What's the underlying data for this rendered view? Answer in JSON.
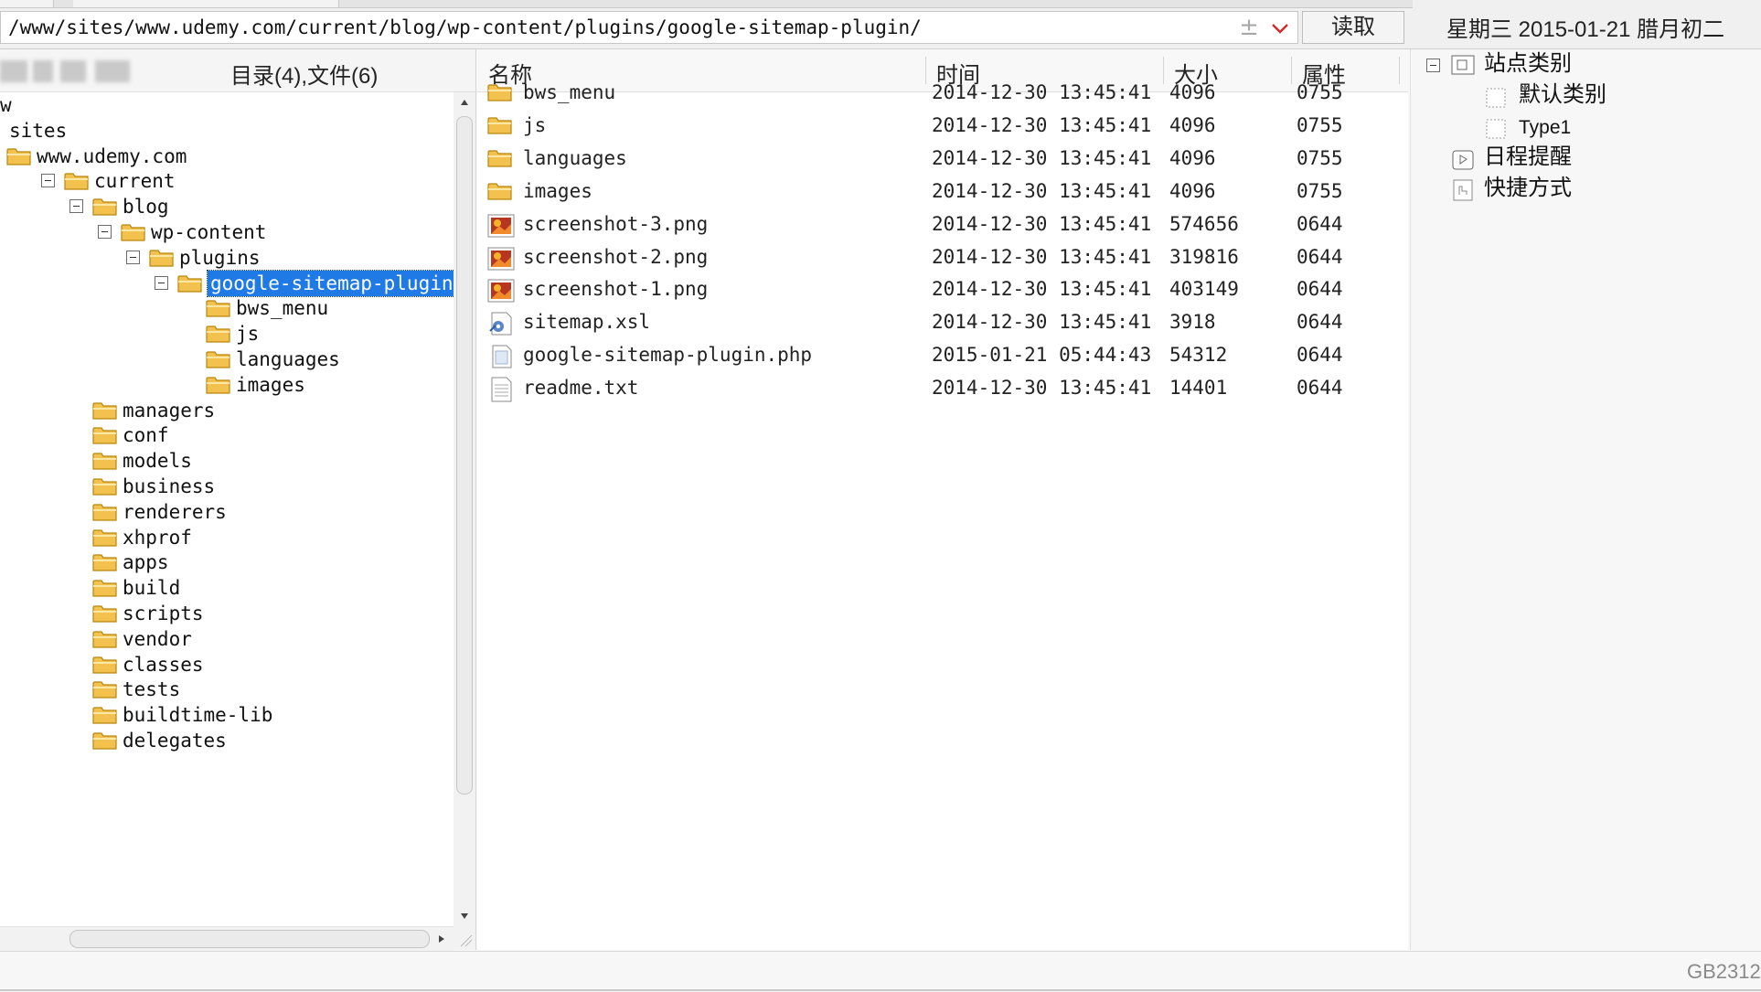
{
  "toolbar": {
    "path": "/www/sites/www.udemy.com/current/blog/wp-content/plugins/google-sitemap-plugin/",
    "bookmark_glyph": "±",
    "read_label": "读取",
    "date": "星期三  2015-01-21  腊月初二"
  },
  "left_panel": {
    "dir_count": "目录(4),文件(6)",
    "tree": [
      {
        "label": "w",
        "indent": 0,
        "type": "text"
      },
      {
        "label": "sites",
        "indent": 0,
        "type": "text"
      },
      {
        "label": "www.udemy.com",
        "indent": 0,
        "type": "folder",
        "toggle": false
      },
      {
        "label": "current",
        "indent": 1,
        "type": "folder",
        "toggle": true
      },
      {
        "label": "blog",
        "indent": 2,
        "type": "folder",
        "toggle": true
      },
      {
        "label": "wp-content",
        "indent": 3,
        "type": "folder",
        "toggle": true
      },
      {
        "label": "plugins",
        "indent": 4,
        "type": "folder",
        "toggle": true
      },
      {
        "label": "google-sitemap-plugin",
        "indent": 5,
        "type": "folder",
        "toggle": true,
        "selected": true
      },
      {
        "label": "bws_menu",
        "indent": 6,
        "type": "folder"
      },
      {
        "label": "js",
        "indent": 6,
        "type": "folder"
      },
      {
        "label": "languages",
        "indent": 6,
        "type": "folder"
      },
      {
        "label": "images",
        "indent": 6,
        "type": "folder"
      },
      {
        "label": "managers",
        "indent": 2,
        "type": "folder"
      },
      {
        "label": "conf",
        "indent": 2,
        "type": "folder"
      },
      {
        "label": "models",
        "indent": 2,
        "type": "folder"
      },
      {
        "label": "business",
        "indent": 2,
        "type": "folder"
      },
      {
        "label": "renderers",
        "indent": 2,
        "type": "folder"
      },
      {
        "label": "xhprof",
        "indent": 2,
        "type": "folder"
      },
      {
        "label": "apps",
        "indent": 2,
        "type": "folder"
      },
      {
        "label": "build",
        "indent": 2,
        "type": "folder"
      },
      {
        "label": "scripts",
        "indent": 2,
        "type": "folder"
      },
      {
        "label": "vendor",
        "indent": 2,
        "type": "folder"
      },
      {
        "label": "classes",
        "indent": 2,
        "type": "folder"
      },
      {
        "label": "tests",
        "indent": 2,
        "type": "folder"
      },
      {
        "label": "buildtime-lib",
        "indent": 2,
        "type": "folder"
      },
      {
        "label": "delegates",
        "indent": 2,
        "type": "folder"
      }
    ]
  },
  "file_list": {
    "columns": {
      "name": "名称",
      "time": "时间",
      "size": "大小",
      "attr": "属性"
    },
    "rows": [
      {
        "name": "bws_menu",
        "time": "2014-12-30 13:45:41",
        "size": "4096",
        "attr": "0755",
        "icon": "folder"
      },
      {
        "name": "js",
        "time": "2014-12-30 13:45:41",
        "size": "4096",
        "attr": "0755",
        "icon": "folder"
      },
      {
        "name": "languages",
        "time": "2014-12-30 13:45:41",
        "size": "4096",
        "attr": "0755",
        "icon": "folder"
      },
      {
        "name": "images",
        "time": "2014-12-30 13:45:41",
        "size": "4096",
        "attr": "0755",
        "icon": "folder"
      },
      {
        "name": "screenshot-3.png",
        "time": "2014-12-30 13:45:41",
        "size": "574656",
        "attr": "0644",
        "icon": "image"
      },
      {
        "name": "screenshot-2.png",
        "time": "2014-12-30 13:45:41",
        "size": "319816",
        "attr": "0644",
        "icon": "image"
      },
      {
        "name": "screenshot-1.png",
        "time": "2014-12-30 13:45:41",
        "size": "403149",
        "attr": "0644",
        "icon": "image"
      },
      {
        "name": "sitemap.xsl",
        "time": "2014-12-30 13:45:41",
        "size": "3918",
        "attr": "0644",
        "icon": "xsl"
      },
      {
        "name": "google-sitemap-plugin.php",
        "time": "2015-01-21 05:44:43",
        "size": "54312",
        "attr": "0644",
        "icon": "php"
      },
      {
        "name": "readme.txt",
        "time": "2014-12-30 13:45:41",
        "size": "14401",
        "attr": "0644",
        "icon": "text"
      }
    ]
  },
  "right_panel": {
    "site_category": "站点类别",
    "default_category": "默认类别",
    "type1": "Type1",
    "schedule": "日程提醒",
    "shortcut": "快捷方式"
  },
  "status": {
    "encoding": "GB2312"
  },
  "colors": {
    "selection": "#1f7ae6",
    "folder": "#f2c14e",
    "folder_stroke": "#b8860b",
    "dropdown": "#d42a2a"
  }
}
